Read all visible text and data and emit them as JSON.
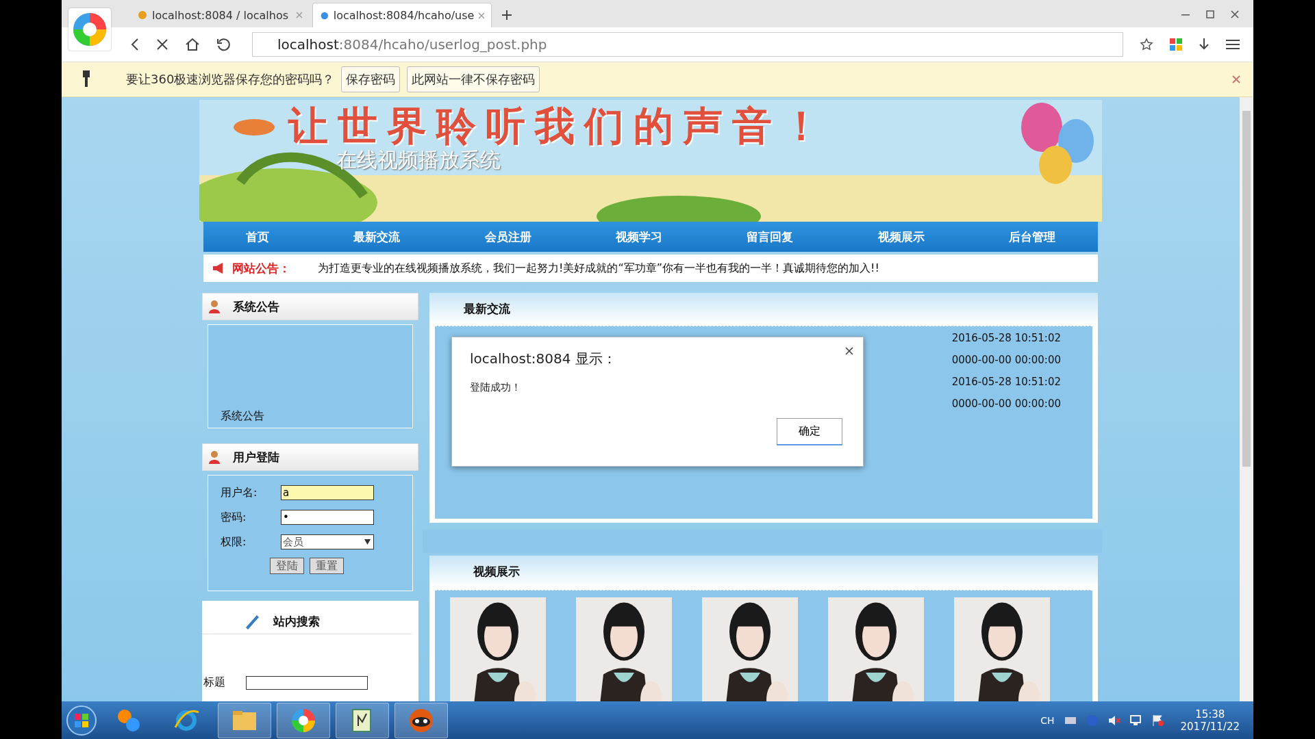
{
  "browser": {
    "tabs": [
      {
        "title": "localhost:8084 / localhos",
        "selected": false
      },
      {
        "title": "localhost:8084/hcaho/use",
        "selected": true
      }
    ],
    "url_host": "localhost",
    "url_rest": ":8084/hcaho/userlog_post.php"
  },
  "password_bar": {
    "message": "要让360极速浏览器保存您的密码吗？",
    "buttons": [
      "保存密码",
      "此网站一律不保存密码"
    ]
  },
  "banner": {
    "slogan": "让世界聆听我们的声音！",
    "subtitle": "在线视频播放系统"
  },
  "nav": [
    "首页",
    "最新交流",
    "会员注册",
    "视频学习",
    "留言回复",
    "视频展示",
    "后台管理"
  ],
  "notice": {
    "label": "网站公告：",
    "text": "为打造更专业的在线视频播放系统，我们一起努力!美好成就的“军功章”你有一半也有我的一半！真诚期待您的加入!!"
  },
  "announcement_panel": {
    "title": "系统公告",
    "item": "系统公告"
  },
  "login_panel": {
    "title": "用户登陆",
    "fields": [
      {
        "label": "用户名:",
        "value": "a",
        "kind": "text"
      },
      {
        "label": "密码:",
        "value": "•",
        "kind": "password"
      },
      {
        "label": "权限:",
        "value": "会员",
        "kind": "select"
      }
    ],
    "buttons": [
      "登陆",
      "重置"
    ]
  },
  "search_panel": {
    "title": "站内搜索",
    "fields": [
      {
        "label": "标题"
      }
    ]
  },
  "latest_panel": {
    "title": "最新交流",
    "times": [
      "2016-05-28 10:51:02",
      "0000-00-00 00:00:00",
      "2016-05-28 10:51:02",
      "0000-00-00 00:00:00"
    ]
  },
  "video_panel": {
    "title": "视频展示"
  },
  "dialog": {
    "title": "localhost:8084 显示：",
    "message": "登陆成功！",
    "button": "确定"
  },
  "taskbar": {
    "language": "CH",
    "time": "15:38",
    "date": "2017/11/22"
  }
}
